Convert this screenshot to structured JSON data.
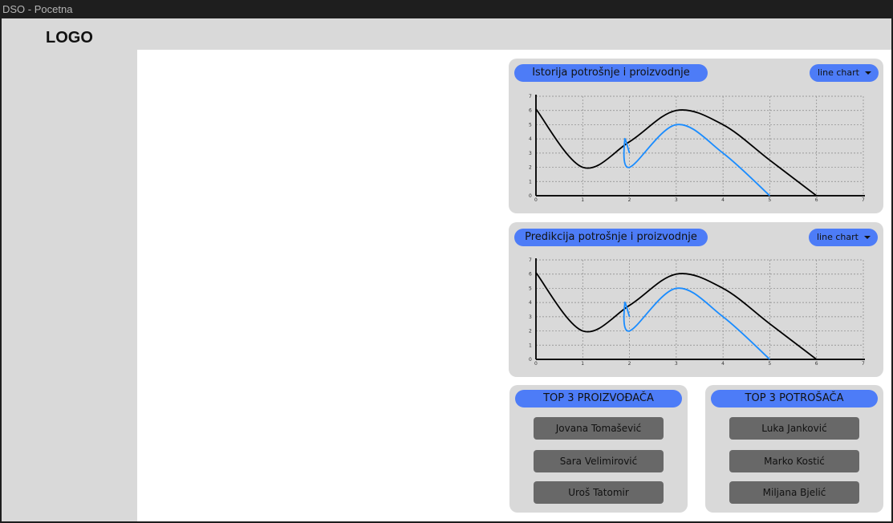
{
  "window": {
    "title": "DSO - Pocetna"
  },
  "header": {
    "logo": "LOGO"
  },
  "history_card": {
    "title": "Istorija potrošnje i proizvodnje",
    "dropdown": "line chart"
  },
  "prediction_card": {
    "title": "Predikcija potrošnje i proizvodnje",
    "dropdown": "line chart"
  },
  "chart_data": [
    {
      "type": "line",
      "title": "Istorija potrošnje i proizvodnje",
      "xlim": [
        0,
        7
      ],
      "ylim": [
        0,
        7
      ],
      "xticks": [
        "0",
        "1",
        "2",
        "3",
        "4",
        "5",
        "6",
        "7"
      ],
      "yticks": [
        "0",
        "1",
        "2",
        "3",
        "4",
        "5",
        "6",
        "7"
      ],
      "grid": true,
      "series": [
        {
          "color": "#000000",
          "x": [
            0,
            1,
            2,
            3,
            4,
            5,
            6
          ],
          "y": [
            6.1,
            2,
            3.8,
            6,
            5,
            2.5,
            0
          ]
        },
        {
          "color": "#1a8cff",
          "x": [
            2,
            1.9,
            2,
            3,
            4,
            5
          ],
          "y": [
            3,
            4,
            2,
            5,
            3,
            0
          ]
        }
      ]
    },
    {
      "type": "line",
      "title": "Predikcija potrošnje i proizvodnje",
      "xlim": [
        0,
        7
      ],
      "ylim": [
        0,
        7
      ],
      "xticks": [
        "0",
        "1",
        "2",
        "3",
        "4",
        "5",
        "6",
        "7"
      ],
      "yticks": [
        "0",
        "1",
        "2",
        "3",
        "4",
        "5",
        "6",
        "7"
      ],
      "grid": true,
      "series": [
        {
          "color": "#000000",
          "x": [
            0,
            1,
            2,
            3,
            4,
            5,
            6
          ],
          "y": [
            6.1,
            2,
            3.8,
            6,
            5,
            2.5,
            0
          ]
        },
        {
          "color": "#1a8cff",
          "x": [
            2,
            1.9,
            2,
            3,
            4,
            5
          ],
          "y": [
            3,
            4,
            2,
            5,
            3,
            0
          ]
        }
      ]
    }
  ],
  "producers": {
    "title": "TOP 3 PROIZVOĐAČA",
    "items": [
      "Jovana Tomašević",
      "Sara Velimirović",
      "Uroš Tatomir"
    ]
  },
  "consumers": {
    "title": "TOP 3 POTROŠAČA",
    "items": [
      "Luka Janković",
      "Marko Kostić",
      "Miljana Bjelić"
    ]
  }
}
